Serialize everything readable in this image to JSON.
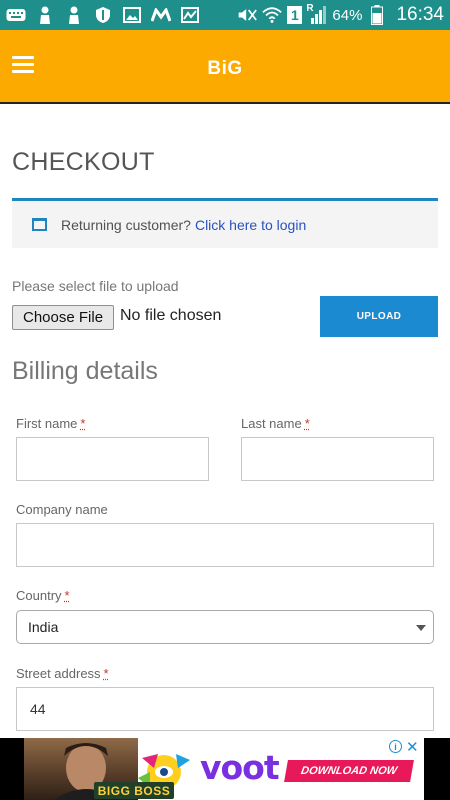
{
  "status_bar": {
    "battery_percent": "64%",
    "time": "16:34",
    "sim_slot": "1",
    "roaming": "R",
    "icons": [
      "keyboard-icon",
      "notification-icon",
      "notification-icon",
      "shield-icon",
      "image-icon",
      "messaging-icon",
      "gallery-icon",
      "mute-icon",
      "wifi-icon",
      "signal-icon",
      "battery-icon"
    ]
  },
  "app_bar": {
    "title": "BiG"
  },
  "checkout": {
    "title": "CHECKOUT",
    "login_prompt": "Returning customer?",
    "login_link": "Click here to login"
  },
  "upload": {
    "label": "Please select file to upload",
    "choose_file_label": "Choose File",
    "no_file_text": "No file chosen",
    "upload_button": "UPLOAD"
  },
  "billing": {
    "title": "Billing details",
    "required_mark": "*",
    "first_name": {
      "label": "First name",
      "value": ""
    },
    "last_name": {
      "label": "Last name",
      "value": ""
    },
    "company_name": {
      "label": "Company name",
      "value": ""
    },
    "country": {
      "label": "Country",
      "value": "India"
    },
    "street_address": {
      "label": "Street address",
      "value": "44"
    }
  },
  "ad": {
    "show_text": "BIGG BOSS",
    "brand": "voot",
    "cta": "DOWNLOAD NOW",
    "info_symbol": "i",
    "close_symbol": "✕"
  }
}
